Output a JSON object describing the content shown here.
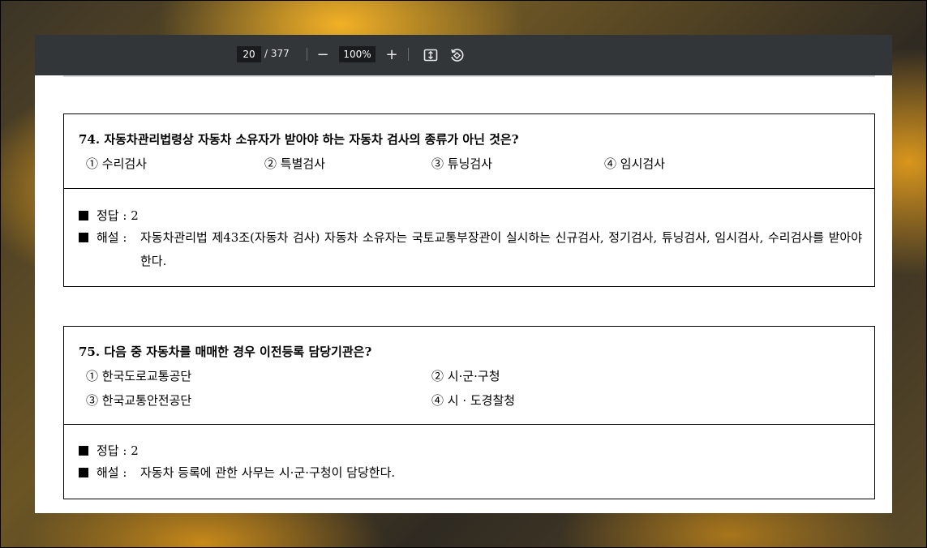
{
  "toolbar": {
    "current_page": "20",
    "total_pages": "/ 377",
    "zoom": "100%",
    "zoom_out_symbol": "−",
    "zoom_in_symbol": "+",
    "fit_icon": "fit-page-icon",
    "rotate_icon": "rotate-icon"
  },
  "questions": [
    {
      "title": "74. 자동차관리법령상 자동차 소유자가 받아야 하는 자동차 검사의 종류가 아닌 것은?",
      "options": [
        "① 수리검사",
        "② 특별검사",
        "③ 튜닝검사",
        "④ 임시검사"
      ],
      "answer_label": "정답 : 2",
      "explain_label": "해설 :",
      "explain_text": "자동차관리법 제43조(자동차 검사) 자동차 소유자는 국토교통부장관이 실시하는 신규검사, 정기검사, 튜닝검사, 임시검사, 수리검사를 받아야 한다."
    },
    {
      "title": "75. 다음 중 자동차를 매매한 경우 이전등록 담당기관은?",
      "options": [
        "① 한국도로교통공단",
        "② 시·군·구청",
        "③ 한국교통안전공단",
        "④ 시 · 도경찰청"
      ],
      "answer_label": "정답 : 2",
      "explain_label": "해설 :",
      "explain_text": "자동차 등록에 관한 사무는 시·군·구청이 담당한다."
    }
  ]
}
